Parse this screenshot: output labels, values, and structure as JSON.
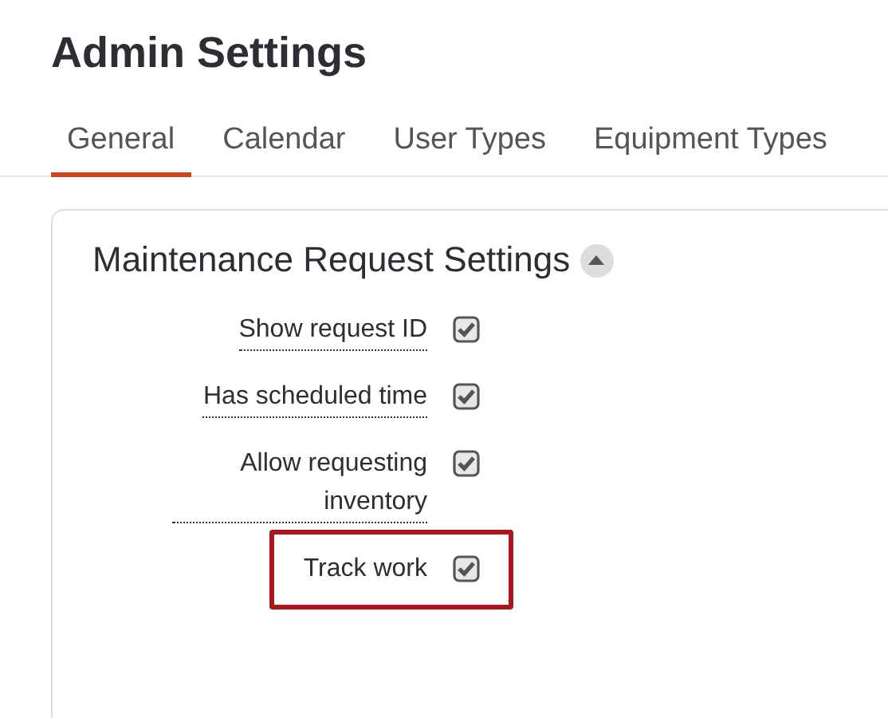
{
  "page": {
    "title": "Admin Settings"
  },
  "tabs": [
    {
      "label": "General",
      "selected": true
    },
    {
      "label": "Calendar",
      "selected": false
    },
    {
      "label": "User Types",
      "selected": false
    },
    {
      "label": "Equipment Types",
      "selected": false
    }
  ],
  "section": {
    "title": "Maintenance Request Settings",
    "expanded": true,
    "settings": [
      {
        "label": "Show request ID",
        "checked": true,
        "has_tooltip": true,
        "highlighted": false
      },
      {
        "label": "Has scheduled time",
        "checked": true,
        "has_tooltip": true,
        "highlighted": false
      },
      {
        "label": "Allow requesting inventory",
        "checked": true,
        "has_tooltip": true,
        "highlighted": false
      },
      {
        "label": "Track work",
        "checked": true,
        "has_tooltip": false,
        "highlighted": true
      }
    ]
  }
}
